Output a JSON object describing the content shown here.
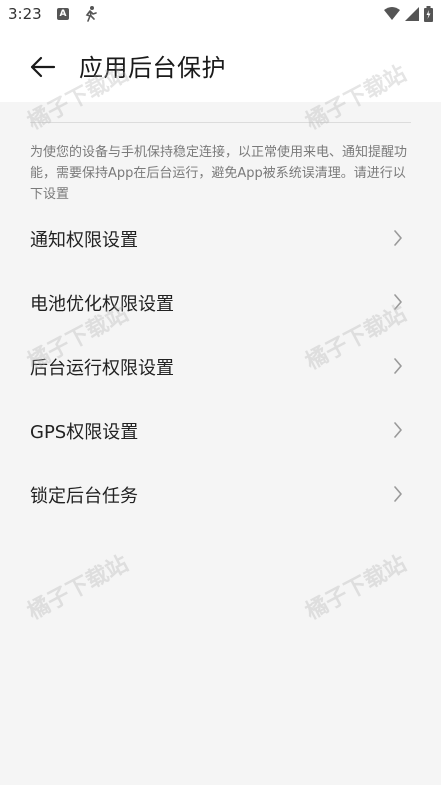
{
  "status_bar": {
    "time": "3:23",
    "icons": [
      "a-notification-icon",
      "running-icon",
      "wifi-icon",
      "signal-icon",
      "battery-icon"
    ]
  },
  "header": {
    "title": "应用后台保护",
    "back_icon": "arrow-left-icon"
  },
  "description": "为使您的设备与手机保持稳定连接，以正常使用来电、通知提醒功能，需要保持App在后台运行，避免App被系统误清理。请进行以下设置",
  "menu": {
    "items": [
      {
        "label": "通知权限设置"
      },
      {
        "label": "电池优化权限设置"
      },
      {
        "label": "后台运行权限设置"
      },
      {
        "label": "GPS权限设置"
      },
      {
        "label": "锁定后台任务"
      }
    ]
  },
  "watermark": "橘子下载站",
  "colors": {
    "background": "#f5f5f5",
    "header_bg": "#ffffff",
    "text_primary": "#222222",
    "text_secondary": "#7a7a7a",
    "chevron": "#9a9a9a"
  }
}
